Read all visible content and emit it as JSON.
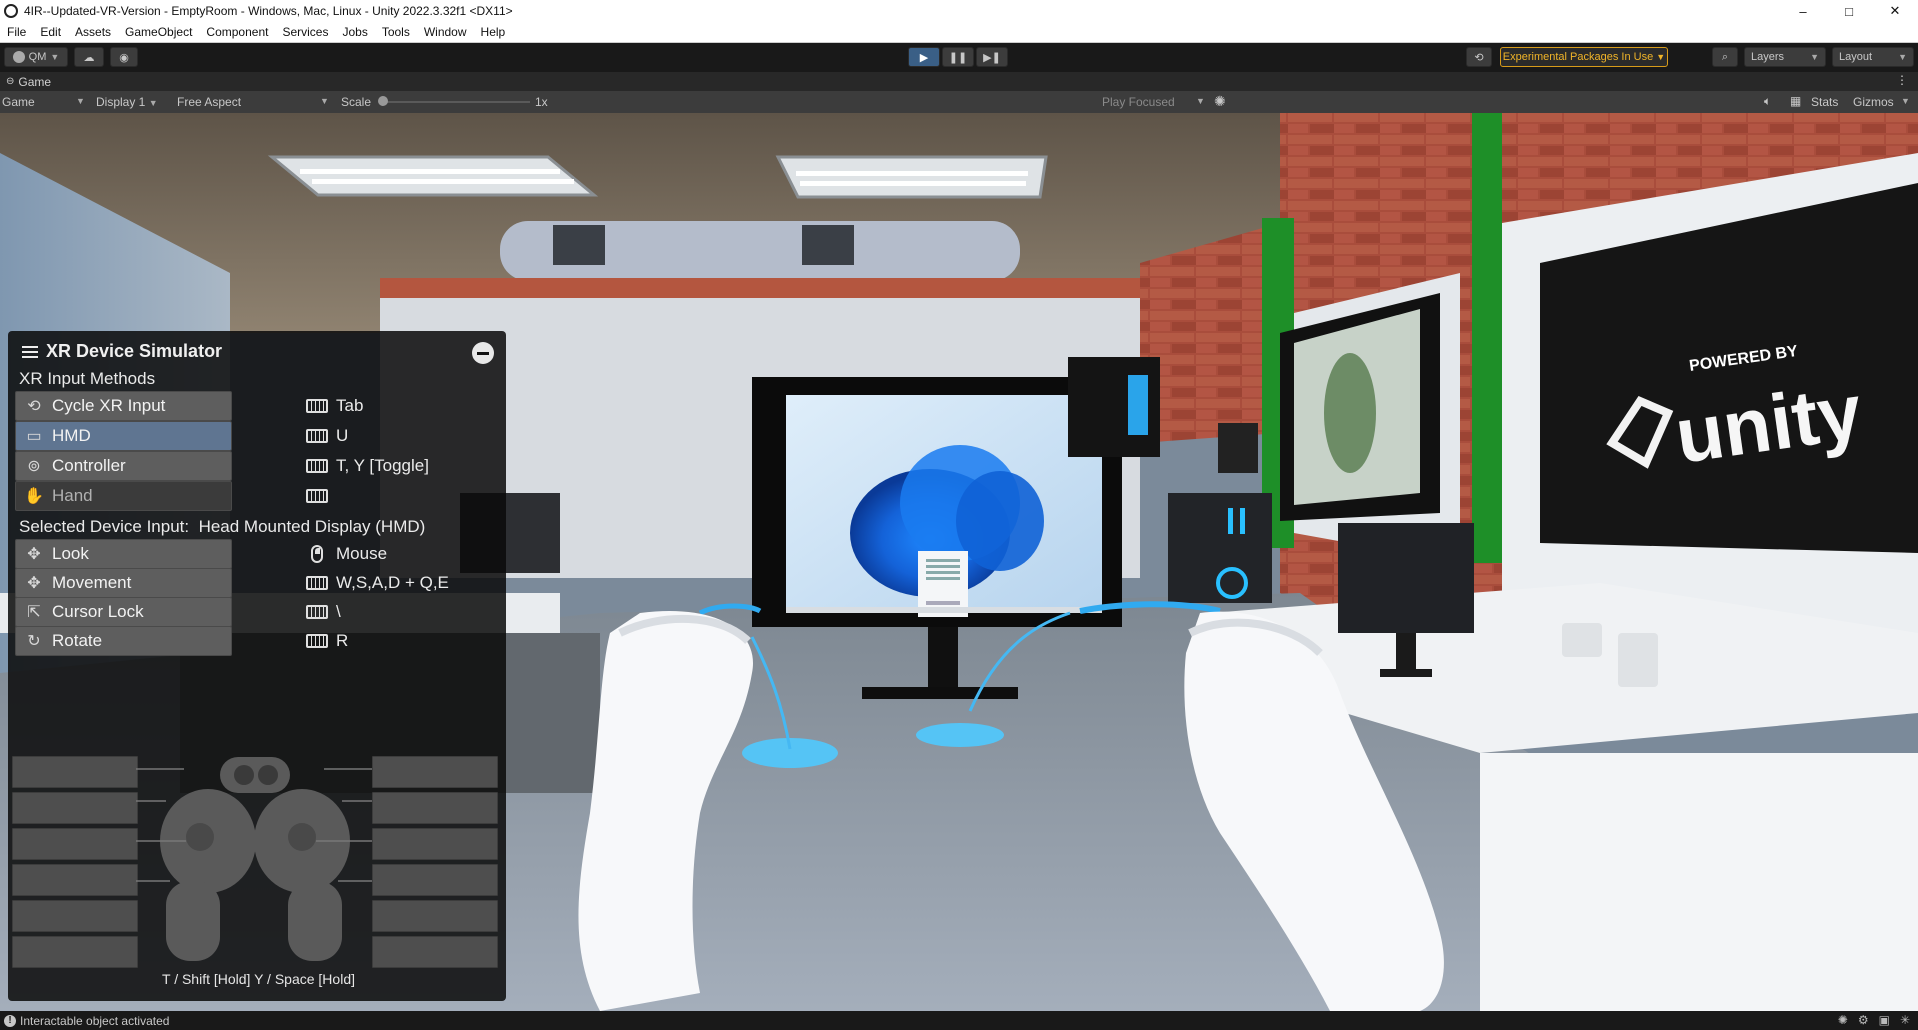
{
  "window": {
    "title": "4IR--Updated-VR-Version - EmptyRoom - Windows, Mac, Linux - Unity 2022.3.32f1 <DX11>",
    "controls": [
      "–",
      "□",
      "✕"
    ]
  },
  "menu": [
    "File",
    "Edit",
    "Assets",
    "GameObject",
    "Component",
    "Services",
    "Jobs",
    "Tools",
    "Window",
    "Help"
  ],
  "toolbar": {
    "account": "QM",
    "experimental": "Experimental Packages In Use",
    "layers": "Layers",
    "layout": "Layout"
  },
  "game_tab": {
    "label": "Game"
  },
  "game_toolbar": {
    "view": "Game",
    "display": "Display 1",
    "aspect": "Free Aspect",
    "scale_label": "Scale",
    "scale_value": "1x",
    "play_focused": "Play Focused",
    "stats": "Stats",
    "gizmos": "Gizmos"
  },
  "scene": {
    "poster_line1": "POWERED BY",
    "poster_line2": "unity"
  },
  "xr_sim": {
    "title": "XR Device Simulator",
    "input_methods_label": "XR Input Methods",
    "methods": [
      {
        "label": "Cycle XR Input",
        "key": "Tab"
      },
      {
        "label": "HMD",
        "key": "U"
      },
      {
        "label": "Controller",
        "key": "T, Y [Toggle]"
      },
      {
        "label": "Hand",
        "key": ""
      }
    ],
    "selected_label": "Selected Device Input:",
    "selected_value": "Head Mounted Display (HMD)",
    "actions": [
      {
        "label": "Look",
        "key": "Mouse"
      },
      {
        "label": "Movement",
        "key": "W,S,A,D + Q,E"
      },
      {
        "label": "Cursor Lock",
        "key": "\\"
      },
      {
        "label": "Rotate",
        "key": "R"
      }
    ],
    "footer": "T / Shift [Hold]   Y / Space [Hold]"
  },
  "status": {
    "message": "Interactable object activated"
  }
}
